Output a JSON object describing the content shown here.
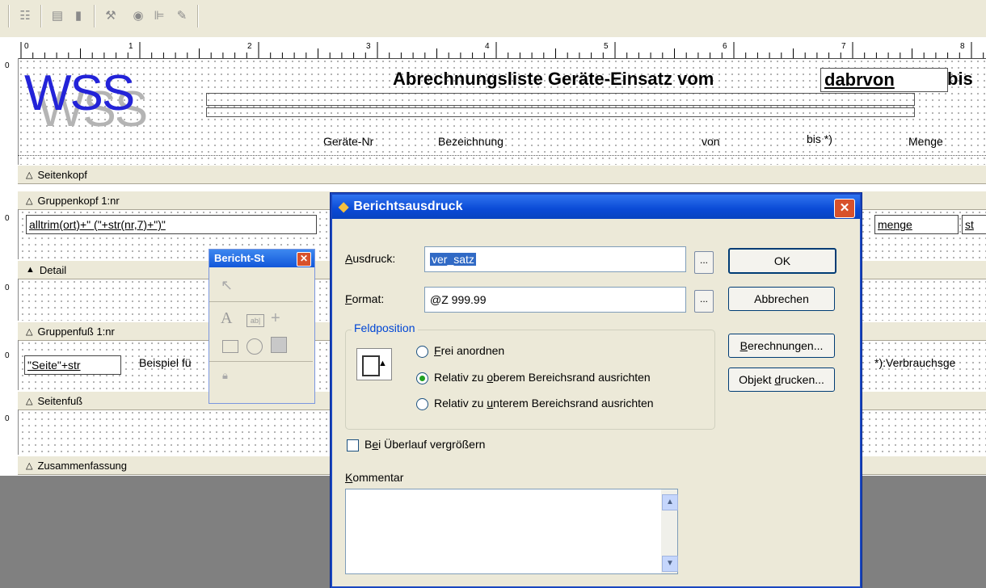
{
  "toolbar": {
    "icons": [
      "list-icon",
      "layout-icon",
      "page-icon",
      "tools-icon",
      "globe-icon",
      "align-icon",
      "paint-icon"
    ]
  },
  "ruler": {
    "numbers": [
      "0",
      "1",
      "2",
      "3",
      "4",
      "5",
      "6",
      "7",
      "8"
    ]
  },
  "report": {
    "logo_text": "WSS",
    "title_text": "Abrechnungsliste Geräte-Einsatz vom",
    "title_field1": "dabrvon",
    "title_field2": "bis",
    "col_geraete_nr": "Geräte-Nr",
    "col_bezeichnung": "Bezeichnung",
    "col_von": "von",
    "col_bis": "bis *)",
    "col_menge": "Menge",
    "band_seitenkopf": "Seitenkopf",
    "band_gruppenkopf": "Gruppenkopf 1:nr",
    "gruppenkopf_expr": "alltrim(ort)+\"   (\"+str(nr,7)+\")\"",
    "gruppenkopf_field_menge": "menge",
    "gruppenkopf_field_st": "st",
    "band_detail": "Detail",
    "band_gruppenfuss": "Gruppenfuß 1:nr",
    "gruppenfuss_field": "\"Seite\"+str",
    "gruppenfuss_text": "Beispiel fü",
    "gruppenfuss_right": "*):Verbrauchsge",
    "band_seitenfuss": "Seitenfuß",
    "band_zusammenfassung": "Zusammenfassung",
    "vruler_zero": "0"
  },
  "toolbox": {
    "title": "Bericht-St"
  },
  "dialog": {
    "title": "Berichtsausdruck",
    "ausdruck_label": "Ausdruck:",
    "ausdruck_value": "ver_satz",
    "format_label": "Format:",
    "format_value": "@Z 999.99",
    "ellipsis": "...",
    "ok_label": "OK",
    "cancel_label": "Abbrechen",
    "berechnungen_label": "Berechnungen...",
    "objekt_label": "Objekt drucken...",
    "feldposition_label": "Feldposition",
    "radio1": "Frei anordnen",
    "radio2": "Relativ zu oberem Bereichsrand ausrichten",
    "radio3": "Relativ zu unterem Bereichsrand ausrichten",
    "checkbox_label": "Bei Überlauf vergrößern",
    "kommentar_label": "Kommentar"
  },
  "colors": {
    "accent": "#0a4ad6",
    "logo_blue": "#2323d8",
    "logo_gray": "#b4b4b4",
    "close_red": "#d8512b"
  }
}
